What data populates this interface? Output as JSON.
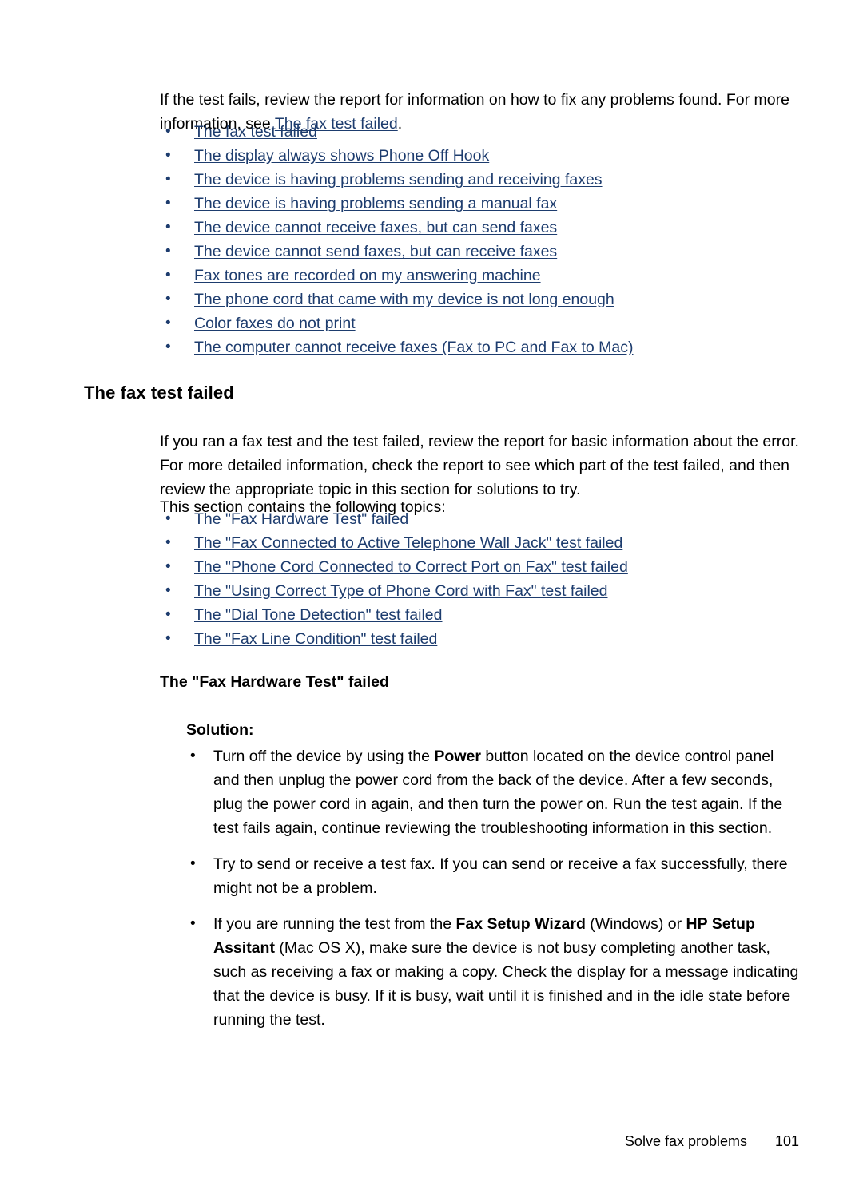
{
  "page": {
    "bullet_glyph": "•",
    "link_color": "#1d3c6e",
    "text_color": "#000000",
    "background": "#ffffff"
  },
  "intro": {
    "before_link": "If the test fails, review the report for information on how to fix any problems found. For more information, see ",
    "link": "The fax test failed",
    "after_link": "."
  },
  "topic_list_1": [
    {
      "label": "The fax test failed"
    },
    {
      "label": "The display always shows Phone Off Hook"
    },
    {
      "label": "The device is having problems sending and receiving faxes"
    },
    {
      "label": "The device is having problems sending a manual fax"
    },
    {
      "label": "The device cannot receive faxes, but can send faxes"
    },
    {
      "label": "The device cannot send faxes, but can receive faxes"
    },
    {
      "label": "Fax tones are recorded on my answering machine"
    },
    {
      "label": "The phone cord that came with my device is not long enough"
    },
    {
      "label": "Color faxes do not print"
    },
    {
      "label": "The computer cannot receive faxes (Fax to PC and Fax to Mac)"
    }
  ],
  "section": {
    "heading": "The fax test failed",
    "paragraph": "If you ran a fax test and the test failed, review the report for basic information about the error. For more detailed information, check the report to see which part of the test failed, and then review the appropriate topic in this section for solutions to try.",
    "lead_in": "This section contains the following topics:"
  },
  "topic_list_2": [
    {
      "label": "The \"Fax Hardware Test\" failed"
    },
    {
      "label": "The \"Fax Connected to Active Telephone Wall Jack\" test failed"
    },
    {
      "label": "The \"Phone Cord Connected to Correct Port on Fax\" test failed"
    },
    {
      "label": "The \"Using Correct Type of Phone Cord with Fax\" test failed"
    },
    {
      "label": "The \"Dial Tone Detection\" test failed"
    },
    {
      "label": "The \"Fax Line Condition\" test failed"
    }
  ],
  "subsection": {
    "heading": "The \"Fax Hardware Test\" failed",
    "solution_label": "Solution:"
  },
  "solution_items": {
    "item1": {
      "part1": "Turn off the device by using the ",
      "bold1": "Power",
      "part2": " button located on the device control panel and then unplug the power cord from the back of the device. After a few seconds, plug the power cord in again, and then turn the power on. Run the test again. If the test fails again, continue reviewing the troubleshooting information in this section."
    },
    "item2": {
      "text": "Try to send or receive a test fax. If you can send or receive a fax successfully, there might not be a problem."
    },
    "item3": {
      "part1": "If you are running the test from the ",
      "bold1": "Fax Setup Wizard",
      "part2": " (Windows) or ",
      "bold2": "HP Setup Assitant",
      "part3": " (Mac OS X), make sure the device is not busy completing another task, such as receiving a fax or making a copy. Check the display for a message indicating that the device is busy. If it is busy, wait until it is finished and in the idle state before running the test."
    }
  },
  "footer": {
    "label": "Solve fax problems",
    "page_number": "101"
  }
}
